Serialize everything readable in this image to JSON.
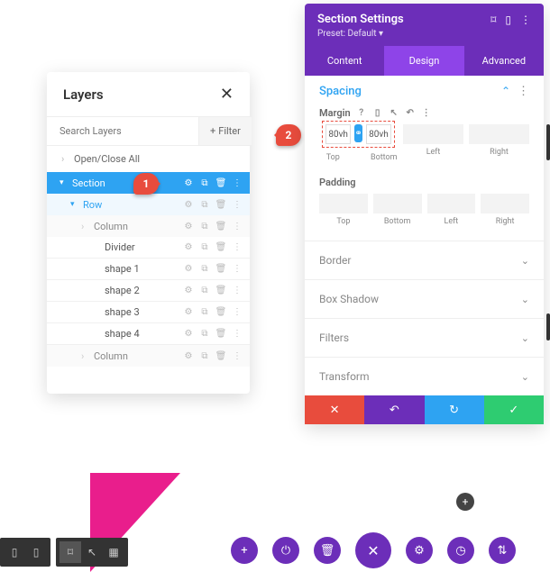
{
  "layers": {
    "title": "Layers",
    "search_placeholder": "Search Layers",
    "filter_label": "Filter",
    "open_close": "Open/Close All",
    "section": "Section",
    "row": "Row",
    "column": "Column",
    "mods": [
      "Divider",
      "shape 1",
      "shape 2",
      "shape 3",
      "shape 4"
    ]
  },
  "markers": {
    "m1": "1",
    "m2": "2"
  },
  "settings": {
    "title": "Section Settings",
    "preset": "Preset: Default ▾",
    "tabs": {
      "content": "Content",
      "design": "Design",
      "advanced": "Advanced"
    },
    "spacing": "Spacing",
    "margin": "Margin",
    "padding": "Padding",
    "margin_vals": {
      "top": "80vh",
      "bottom": "80vh",
      "left": "",
      "right": ""
    },
    "padding_vals": {
      "top": "",
      "bottom": "",
      "left": "",
      "right": ""
    },
    "sides": {
      "top": "Top",
      "bottom": "Bottom",
      "left": "Left",
      "right": "Right"
    },
    "accordions": [
      "Border",
      "Box Shadow",
      "Filters",
      "Transform"
    ]
  },
  "icons": {
    "plus": "+",
    "close": "✕",
    "gear": "⚙",
    "dup": "⧉",
    "trash": "🗑",
    "dots": "⋮",
    "help": "?",
    "tablet": "▯",
    "desktop": "⌑",
    "cursor": "↖",
    "undo": "↶",
    "redo": "↻",
    "check": "✓",
    "power": "⏻",
    "clock": "◷",
    "sliders": "⇅",
    "chev": "⌃",
    "chevd": "⌄",
    "link": "⚭"
  }
}
